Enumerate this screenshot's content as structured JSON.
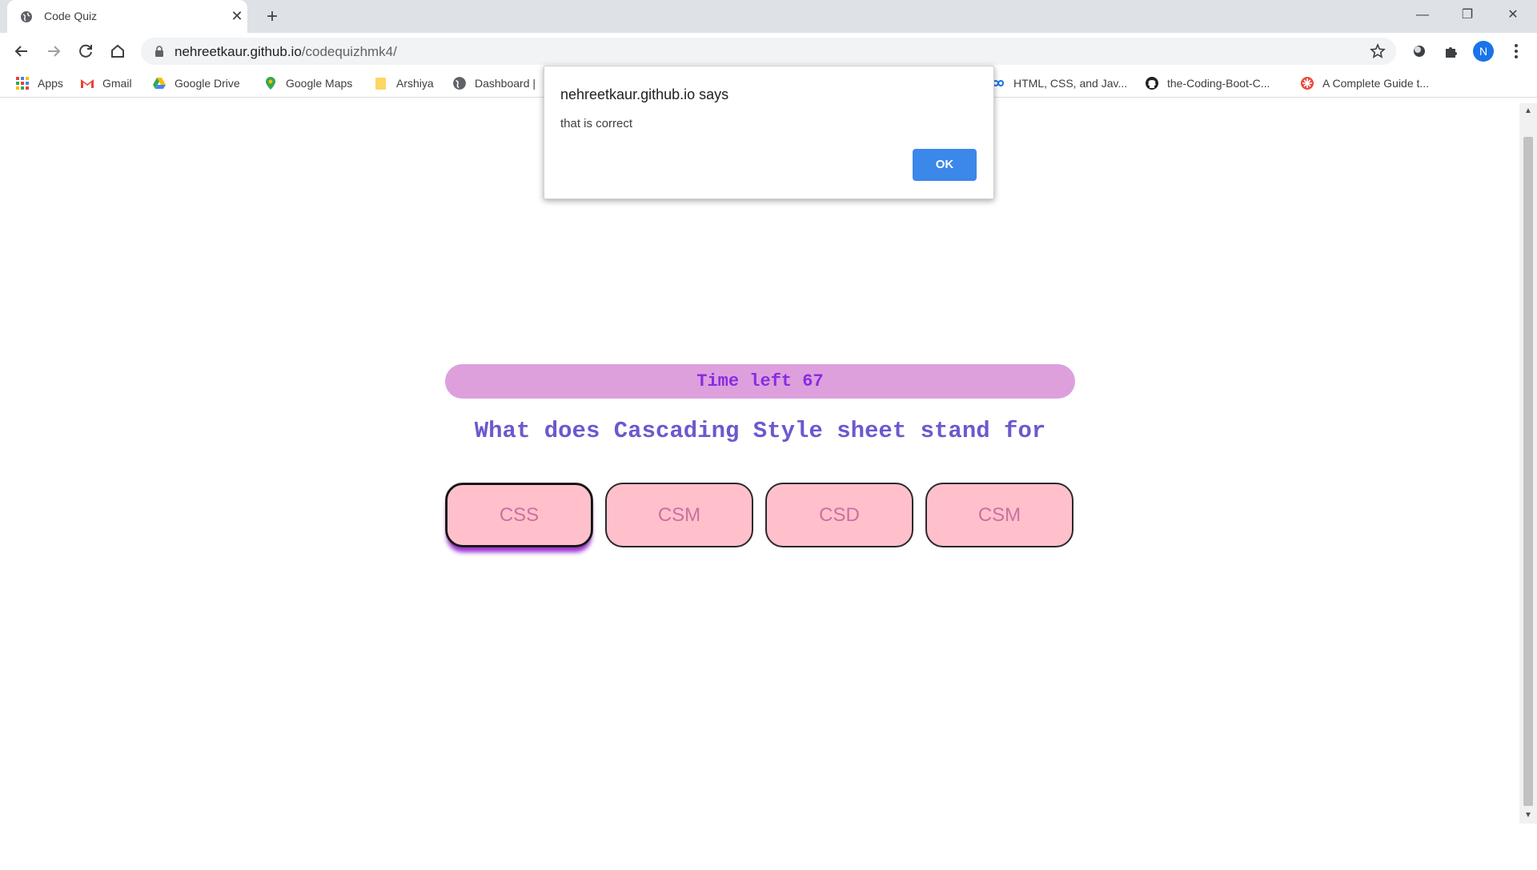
{
  "browser": {
    "tab_title": "Code Quiz",
    "tab_close": "✕",
    "new_tab": "+",
    "window_controls": {
      "minimize": "—",
      "restore": "❐",
      "close": "✕"
    },
    "url_host": "nehreetkaur.github.io",
    "url_path": "/codequizhmk4/",
    "profile_initial": "N"
  },
  "bookmarks": [
    {
      "label": "Apps",
      "icon": "apps-grid-icon"
    },
    {
      "label": "Gmail",
      "icon": "gmail-icon"
    },
    {
      "label": "Google Drive",
      "icon": "drive-icon"
    },
    {
      "label": "Google Maps",
      "icon": "maps-pin-icon"
    },
    {
      "label": "Arshiya",
      "icon": "folder-icon"
    },
    {
      "label": "Dashboard |",
      "icon": "globe-icon"
    },
    {
      "label": "HTML, CSS, and Jav...",
      "icon": "infinity-icon"
    },
    {
      "label": "the-Coding-Boot-C...",
      "icon": "github-icon"
    },
    {
      "label": "A Complete Guide t...",
      "icon": "star-burst-icon"
    }
  ],
  "quiz": {
    "timer_text": "Time left 67",
    "question": "What does Cascading Style sheet stand for",
    "answers": [
      "CSS",
      "CSM",
      "CSD",
      "CSM"
    ]
  },
  "dialog": {
    "title": "nehreetkaur.github.io says",
    "message": "that is correct",
    "ok_label": "OK"
  },
  "colors": {
    "timer_bg": "#dda0dd",
    "timer_text": "#8a2be2",
    "question_text": "#6a5acd",
    "answer_bg": "#ffc0cb",
    "ok_button": "#3b87ea"
  }
}
